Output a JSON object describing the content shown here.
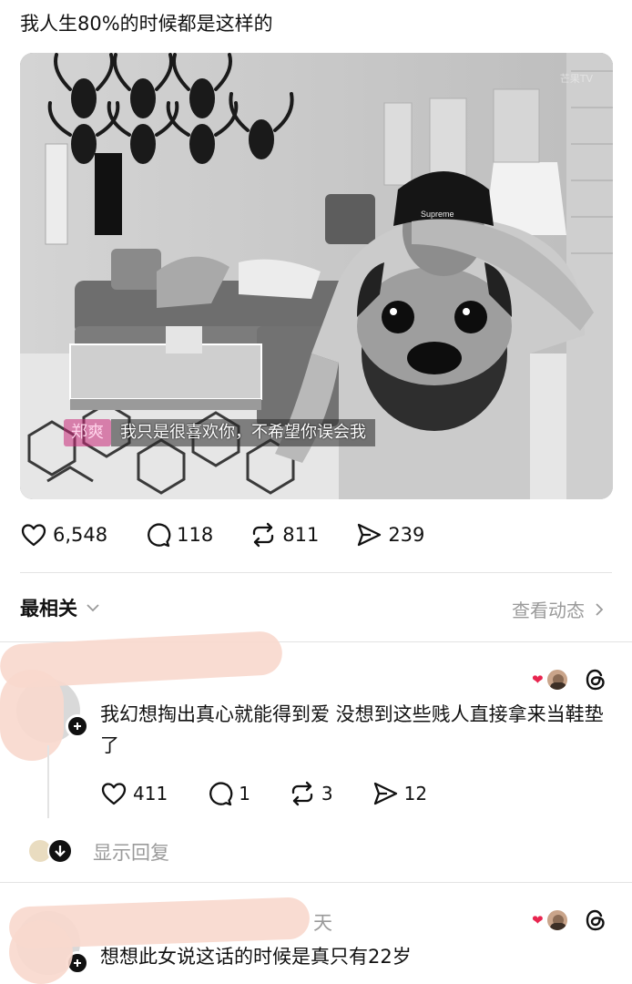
{
  "post": {
    "text": "我人生80%的时候都是这样的",
    "media": {
      "watermark": "芒果TV",
      "speaker": "郑爽",
      "subtitle": "我只是很喜欢你，不希望你误会我"
    },
    "stats": {
      "likes": "6,548",
      "comments": "118",
      "reposts": "811",
      "shares": "239"
    }
  },
  "sort": {
    "label": "最相关",
    "view_activity": "查看动态"
  },
  "comments": [
    {
      "text": "我幻想掏出真心就能得到爱 没想到这些贱人直接拿来当鞋垫了",
      "stats": {
        "likes": "411",
        "replies": "1",
        "reposts": "3",
        "shares": "12"
      },
      "show_replies": "显示回复"
    },
    {
      "time_fragment": "天",
      "text": "想想此女说这话的时候是真只有22岁"
    }
  ],
  "icons": {
    "like": "heart-icon",
    "comment": "comment-bubble-icon",
    "repost": "repost-icon",
    "share": "send-icon",
    "threads": "threads-logo-icon"
  },
  "colors": {
    "muted": "#9a9a9a",
    "accent_heart": "#e8254f",
    "redaction": "#f8d8cd"
  }
}
